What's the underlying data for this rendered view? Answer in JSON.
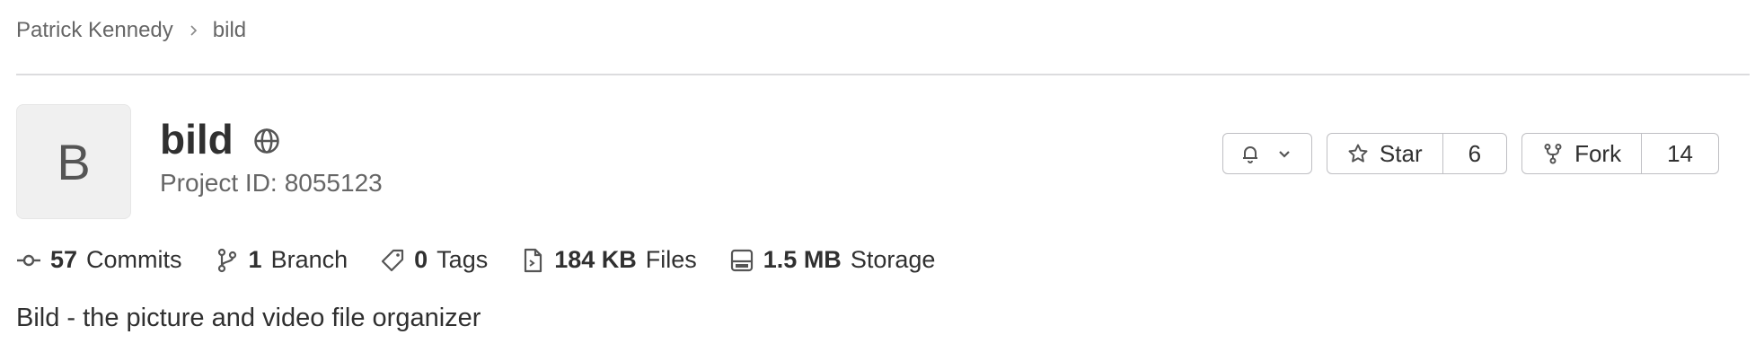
{
  "breadcrumb": {
    "owner": "Patrick Kennedy",
    "project": "bild"
  },
  "project": {
    "avatar_letter": "B",
    "title": "bild",
    "id_label": "Project ID:",
    "id_value": "8055123",
    "visibility_icon": "globe-icon"
  },
  "actions": {
    "notification_icon": "bell-icon",
    "star_label": "Star",
    "star_count": "6",
    "fork_label": "Fork",
    "fork_count": "14"
  },
  "stats": [
    {
      "num": "57",
      "label": "Commits",
      "icon": "commit-icon"
    },
    {
      "num": "1",
      "label": "Branch",
      "icon": "branch-icon"
    },
    {
      "num": "0",
      "label": "Tags",
      "icon": "tag-icon"
    },
    {
      "num": "184 KB",
      "label": "Files",
      "icon": "file-icon"
    },
    {
      "num": "1.5 MB",
      "label": "Storage",
      "icon": "storage-icon"
    }
  ],
  "description": "Bild - the picture and video file organizer",
  "colors": {
    "text": "#303030",
    "muted": "#666666",
    "border": "#bfbfc3",
    "avatar_bg": "#f0f0f0"
  }
}
